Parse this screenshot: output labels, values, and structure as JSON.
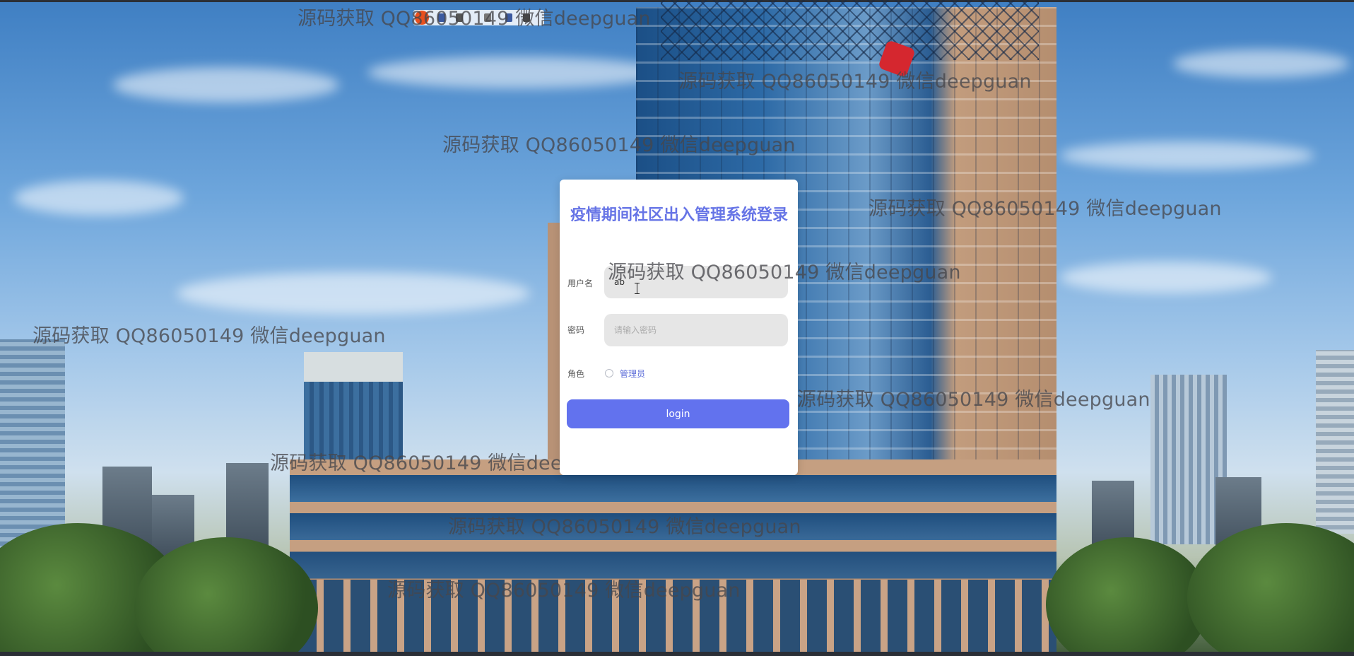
{
  "login": {
    "title": "疫情期间社区出入管理系统登录",
    "username_label": "用户名",
    "username_value": "ab",
    "password_label": "密码",
    "password_placeholder": "请输入密码",
    "role_label": "角色",
    "role_option": "管理员",
    "button_label": "login"
  },
  "watermark": {
    "text": "源码获取 QQ86050149 微信deepguan"
  },
  "colors": {
    "accent": "#6272ee",
    "title": "#6674e6",
    "input_bg": "#e6e6e6"
  }
}
